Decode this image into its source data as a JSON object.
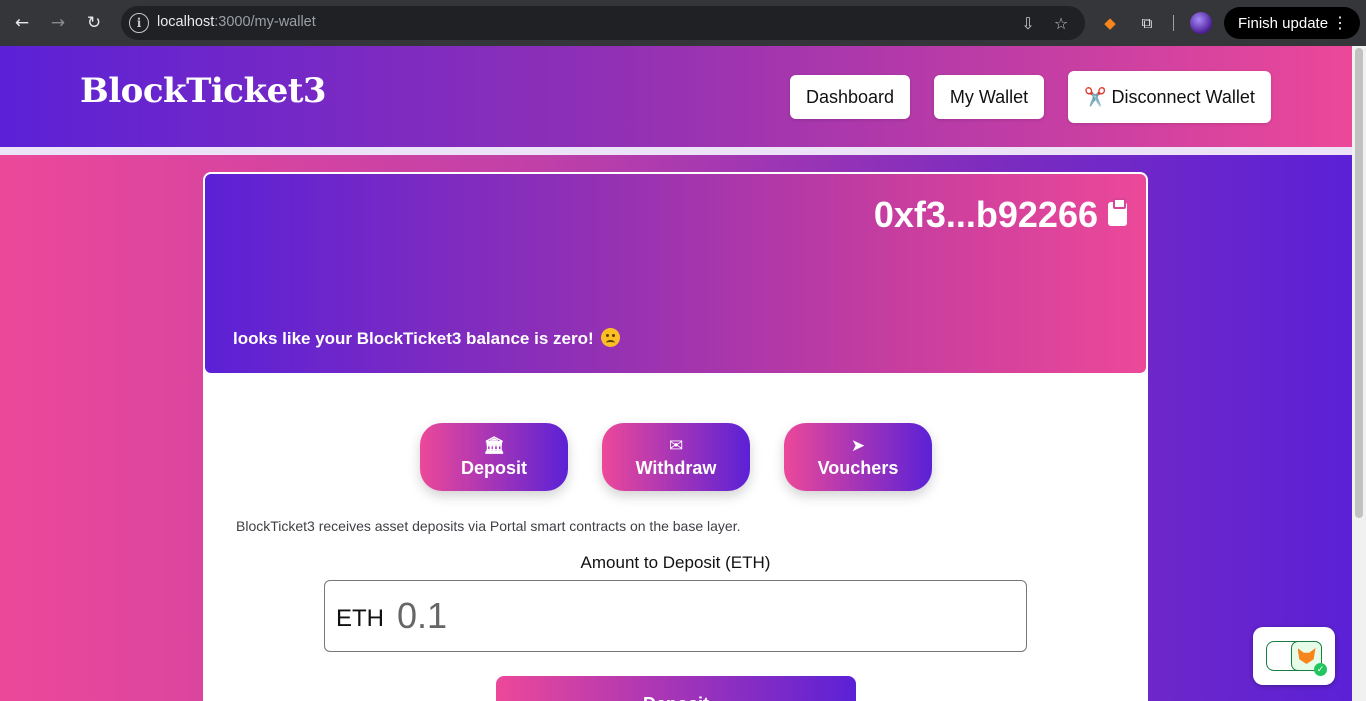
{
  "browser": {
    "url_host": "localhost",
    "url_path": ":3000/my-wallet",
    "finish_update_label": "Finish update",
    "icons": {
      "back": "back-arrow-icon",
      "forward": "forward-arrow-icon",
      "reload": "reload-icon",
      "site_info": "site-info-icon",
      "install": "install-app-icon",
      "bookmark": "star-icon",
      "metamask": "metamask-fox-icon",
      "extensions": "puzzle-icon",
      "menu": "kebab-menu-icon"
    }
  },
  "header": {
    "brand": "BlockTicket3",
    "nav": {
      "dashboard": "Dashboard",
      "my_wallet": "My Wallet",
      "disconnect": "✂️ Disconnect Wallet"
    }
  },
  "wallet": {
    "address": "0xf3...b92266",
    "balance_message": "looks like your BlockTicket3 balance is zero!"
  },
  "actions": {
    "deposit": "Deposit",
    "withdraw": "Withdraw",
    "vouchers": "Vouchers"
  },
  "deposit_form": {
    "info": "BlockTicket3 receives asset deposits via Portal smart contracts on the base layer.",
    "label": "Amount to Deposit (ETH)",
    "unit": "ETH",
    "placeholder": "0.1",
    "submit": "Deposit"
  },
  "colors": {
    "gradient_pink": "#ec4899",
    "gradient_purple": "#5b21d6",
    "browser_frame": "#35363a"
  }
}
